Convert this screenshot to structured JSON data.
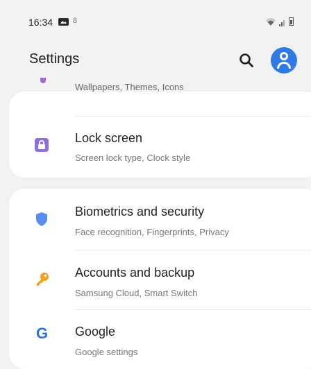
{
  "status_bar": {
    "time": "16:34",
    "misc": "8"
  },
  "header": {
    "title": "Settings"
  },
  "items": {
    "wallpapers": {
      "subtitle": "Wallpapers, Themes, Icons"
    },
    "lock_screen": {
      "title": "Lock screen",
      "subtitle": "Screen lock type, Clock style"
    },
    "biometrics": {
      "title": "Biometrics and security",
      "subtitle": "Face recognition, Fingerprints, Privacy"
    },
    "accounts": {
      "title": "Accounts and backup",
      "subtitle": "Samsung Cloud, Smart Switch"
    },
    "google": {
      "title": "Google",
      "subtitle": "Google settings",
      "icon_glyph": "G"
    }
  },
  "colors": {
    "background": "#f2f2f2",
    "card": "#ffffff",
    "account_blue": "#2f7ae5",
    "lock_purple": "#8c6ee0",
    "shield_blue": "#5b8def",
    "key_orange": "#f4a11a",
    "google_blue": "#2f6fe0"
  },
  "icons": {
    "status": [
      "gallery-icon",
      "wifi-icon",
      "signal-icon",
      "battery-icon"
    ],
    "header": [
      "search-icon",
      "account-icon"
    ],
    "rows": [
      "palette-icon",
      "lock-icon",
      "shield-icon",
      "key-icon",
      "google-icon"
    ]
  }
}
